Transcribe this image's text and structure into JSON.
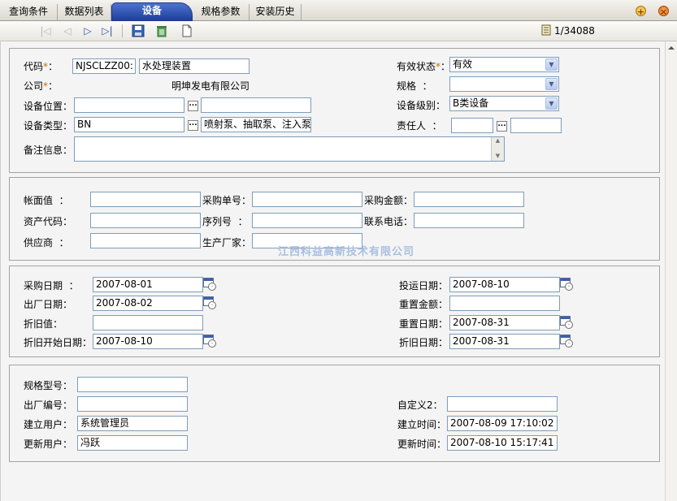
{
  "tabs": [
    "查询条件",
    "数据列表",
    "设备",
    "规格参数",
    "安装历史"
  ],
  "toolbar": {
    "record_counter": "1/34088"
  },
  "basic": {
    "code_label": "代码",
    "code_value": "NJSCLZZ00:",
    "code_name": "水处理装置",
    "status_label": "有效状态",
    "status_value": "有效",
    "company_label": "公司",
    "company_value": "明坤发电有限公司",
    "spec_label": "规格",
    "spec_value": "",
    "location_label": "设备位置",
    "location_code": "",
    "location_name": "",
    "level_label": "设备级别",
    "level_value": "B类设备",
    "type_label": "设备类型",
    "type_code": "BN",
    "type_name": "喷射泵、抽取泵、注入泵",
    "owner_label": "责任人",
    "owner_code": "",
    "owner_name": "",
    "remark_label": "备注信息",
    "remark_value": ""
  },
  "finance": {
    "book_value_label": "帐面值",
    "book_value": "",
    "po_no_label": "采购单号",
    "po_no": "",
    "po_amount_label": "采购金额",
    "po_amount": "",
    "asset_code_label": "资产代码",
    "asset_code": "",
    "serial_label": "序列号",
    "serial": "",
    "phone_label": "联系电话",
    "phone": "",
    "supplier_label": "供应商",
    "supplier": "",
    "manufacturer_label": "生产厂家",
    "manufacturer": ""
  },
  "dates": {
    "purchase_date_label": "采购日期",
    "purchase_date": "2007-08-01",
    "commission_date_label": "投运日期",
    "commission_date": "2007-08-10",
    "factory_date_label": "出厂日期",
    "factory_date": "2007-08-02",
    "reset_amount_label": "重置金额",
    "reset_amount": "",
    "depreciation_label": "折旧值",
    "depreciation": "",
    "reset_date_label": "重置日期",
    "reset_date": "2007-08-31",
    "dep_start_label": "折旧开始日期",
    "dep_start": "2007-08-10",
    "dep_date_label": "折旧日期",
    "dep_date": "2007-08-31"
  },
  "meta": {
    "model_label": "规格型号",
    "model": "",
    "factory_no_label": "出厂编号",
    "factory_no": "",
    "custom2_label": "自定义2",
    "custom2": "",
    "creator_label": "建立用户",
    "creator": "系统管理员",
    "created_label": "建立时间",
    "created": "2007-08-09 17:10:02",
    "updater_label": "更新用户",
    "updater": "冯跃",
    "updated_label": "更新时间",
    "updated": "2007-08-10 15:17:41"
  },
  "watermark": "江西科益高新技术有限公司",
  "colors": {
    "active_tab": "#2a4ead",
    "required": "#c07000",
    "border": "#7f9db9"
  }
}
